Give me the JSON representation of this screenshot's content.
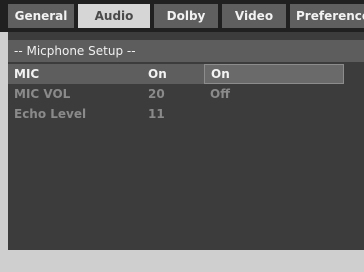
{
  "tabs": [
    {
      "label": "General"
    },
    {
      "label": "Audio"
    },
    {
      "label": "Dolby"
    },
    {
      "label": "Video"
    },
    {
      "label": "Preference"
    }
  ],
  "active_tab": "Audio",
  "section": {
    "title": "-- Micphone Setup --"
  },
  "settings": [
    {
      "label": "MIC",
      "value": "On"
    },
    {
      "label": "MIC VOL",
      "value": "20"
    },
    {
      "label": "Echo Level",
      "value": "11"
    }
  ],
  "options": [
    {
      "label": "On"
    },
    {
      "label": "Off"
    }
  ],
  "selected_option": "On",
  "colors": {
    "tabbar_bg": "#202020",
    "panel_bg": "#3c3c3c",
    "selected_row": "#5e5e5e",
    "dim_text": "#8a8a8a"
  }
}
